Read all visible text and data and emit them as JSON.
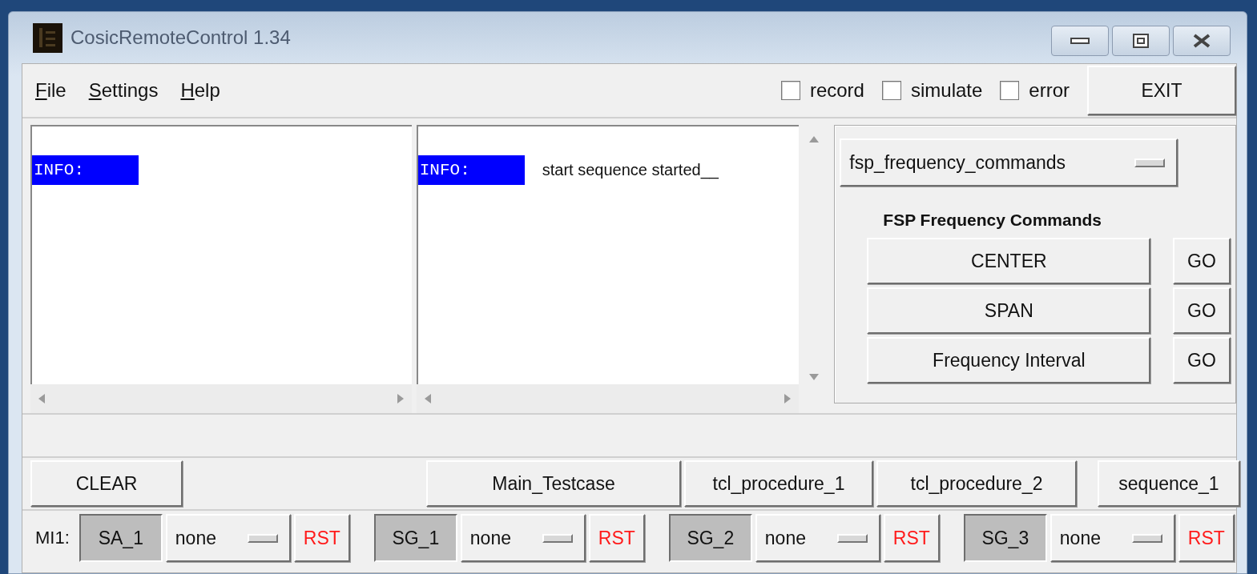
{
  "window": {
    "title": "CosicRemoteControl 1.34"
  },
  "menu": [
    "File",
    "Settings",
    "Help"
  ],
  "options": [
    {
      "label": "record",
      "checked": false
    },
    {
      "label": "simulate",
      "checked": false
    },
    {
      "label": "error",
      "checked": false
    }
  ],
  "exit_button": "EXIT",
  "log_panes": [
    {
      "lines": [
        {
          "tag": "INFO:"
        }
      ]
    },
    {
      "lines": [
        {
          "tag": "INFO:",
          "text": "start sequence started__"
        }
      ]
    }
  ],
  "command_panel": {
    "selector": "fsp_frequency_commands",
    "heading": "FSP Frequency Commands",
    "commands": [
      {
        "label": "CENTER",
        "go": "GO"
      },
      {
        "label": "SPAN",
        "go": "GO"
      },
      {
        "label": "Frequency Interval",
        "go": "GO"
      }
    ]
  },
  "actions": [
    "CLEAR",
    "Main_Testcase",
    "tcl_procedure_1",
    "tcl_procedure_2",
    "sequence_1"
  ],
  "instruments": {
    "label": "MI1:",
    "devices": [
      {
        "name": "SA_1",
        "pressed": true,
        "mode": "none",
        "reset": "RST"
      },
      {
        "name": "SG_1",
        "pressed": true,
        "mode": "none",
        "reset": "RST"
      },
      {
        "name": "SG_2",
        "pressed": true,
        "mode": "none",
        "reset": "RST"
      },
      {
        "name": "SG_3",
        "pressed": true,
        "mode": "none",
        "reset": "RST"
      }
    ]
  }
}
